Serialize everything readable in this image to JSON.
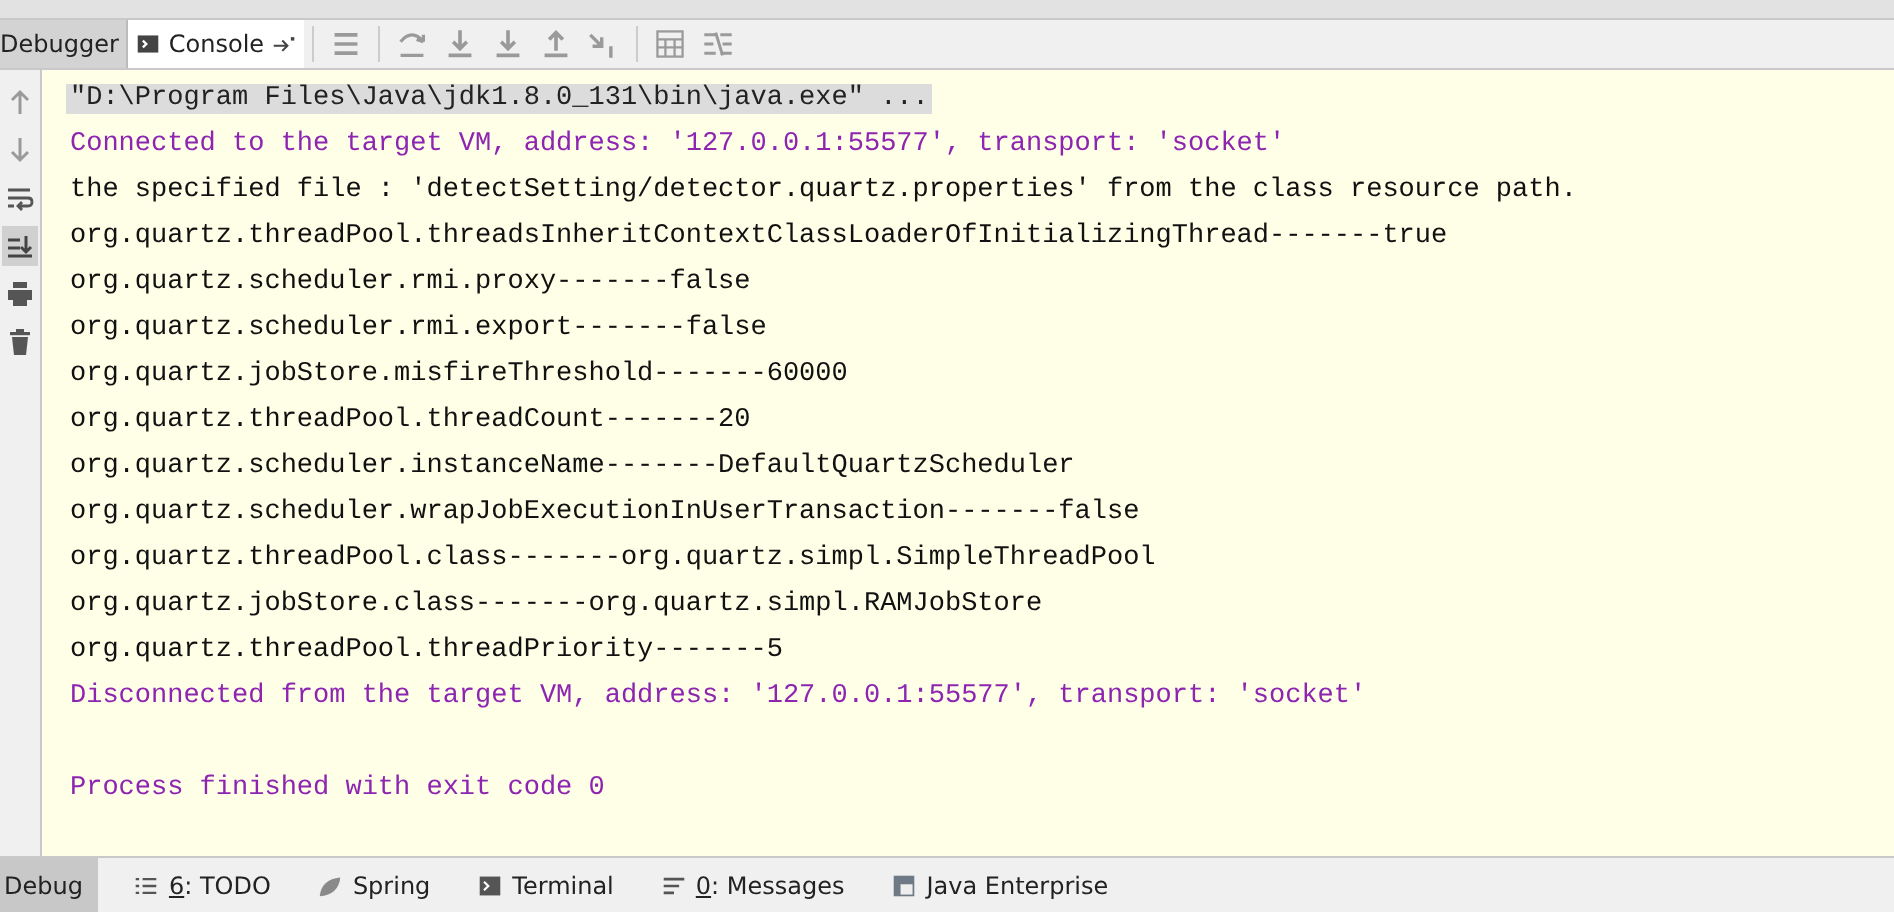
{
  "toolbar": {
    "tabs": [
      {
        "label": "Debugger",
        "selected": false
      },
      {
        "label": "Console",
        "selected": true
      }
    ]
  },
  "gutter": [
    {
      "selected": false
    },
    {
      "selected": false
    },
    {
      "selected": false
    },
    {
      "selected": true
    },
    {
      "selected": false
    },
    {
      "selected": false
    }
  ],
  "console": {
    "lines": [
      {
        "kind": "command",
        "text": "\"D:\\Program Files\\Java\\jdk1.8.0_131\\bin\\java.exe\" ..."
      },
      {
        "kind": "system",
        "text": "Connected to the target VM, address: '127.0.0.1:55577', transport: 'socket'"
      },
      {
        "kind": "output",
        "text": "the specified file : 'detectSetting/detector.quartz.properties' from the class resource path."
      },
      {
        "kind": "output",
        "text": "org.quartz.threadPool.threadsInheritContextClassLoaderOfInitializingThread-------true"
      },
      {
        "kind": "output",
        "text": "org.quartz.scheduler.rmi.proxy-------false"
      },
      {
        "kind": "output",
        "text": "org.quartz.scheduler.rmi.export-------false"
      },
      {
        "kind": "output",
        "text": "org.quartz.jobStore.misfireThreshold-------60000"
      },
      {
        "kind": "output",
        "text": "org.quartz.threadPool.threadCount-------20"
      },
      {
        "kind": "output",
        "text": "org.quartz.scheduler.instanceName-------DefaultQuartzScheduler"
      },
      {
        "kind": "output",
        "text": "org.quartz.scheduler.wrapJobExecutionInUserTransaction-------false"
      },
      {
        "kind": "output",
        "text": "org.quartz.threadPool.class-------org.quartz.simpl.SimpleThreadPool"
      },
      {
        "kind": "output",
        "text": "org.quartz.jobStore.class-------org.quartz.simpl.RAMJobStore"
      },
      {
        "kind": "output",
        "text": "org.quartz.threadPool.threadPriority-------5"
      },
      {
        "kind": "system",
        "text": "Disconnected from the target VM, address: '127.0.0.1:55577', transport: 'socket'"
      },
      {
        "kind": "blank"
      },
      {
        "kind": "system",
        "text": "Process finished with exit code 0"
      }
    ]
  },
  "bottom_bar": [
    {
      "label": "Debug",
      "selected": true
    },
    {
      "mnemonic": "6",
      "label": ": TODO",
      "selected": false
    },
    {
      "label": "Spring",
      "selected": false
    },
    {
      "label": "Terminal",
      "selected": false
    },
    {
      "mnemonic": "0",
      "label": ": Messages",
      "selected": false
    },
    {
      "label": "Java Enterprise",
      "selected": false
    }
  ]
}
